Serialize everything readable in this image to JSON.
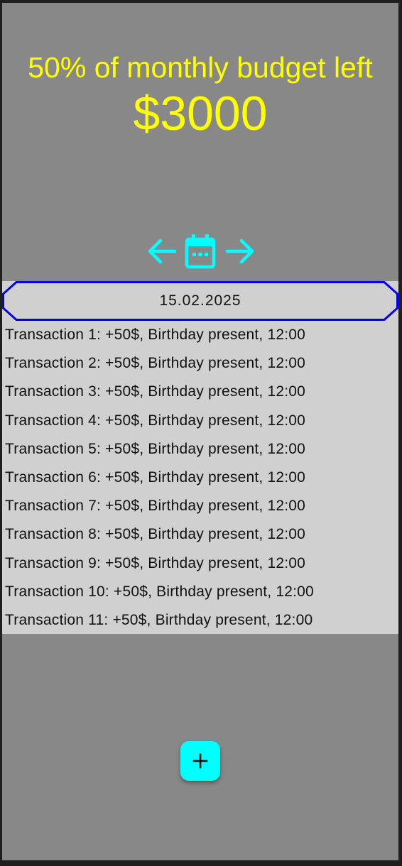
{
  "budget": {
    "headline": "50% of monthly budget left",
    "amount": "$3000"
  },
  "navigation": {
    "prev_icon": "arrow-left-icon",
    "calendar_icon": "calendar-icon",
    "next_icon": "arrow-right-icon",
    "icon_color": "#00ffff"
  },
  "date": "15.02.2025",
  "transactions": [
    "Transaction 1: +50$, Birthday present, 12:00",
    "Transaction 2: +50$, Birthday present, 12:00",
    "Transaction 3: +50$, Birthday present, 12:00",
    "Transaction 4: +50$, Birthday present, 12:00",
    "Transaction 5: +50$, Birthday present, 12:00",
    "Transaction 6: +50$, Birthday present, 12:00",
    "Transaction 7: +50$, Birthday present, 12:00",
    "Transaction 8: +50$, Birthday present, 12:00",
    "Transaction 9: +50$, Birthday present, 12:00",
    "Transaction 10: +50$, Birthday present, 12:00",
    "Transaction 11: +50$, Birthday present, 12:00"
  ],
  "fab": {
    "icon": "plus-icon"
  },
  "colors": {
    "accent": "#00ffff",
    "headline": "#ffff00",
    "background": "#888888",
    "list_background": "#d0d0d0",
    "date_border": "#0000ee"
  }
}
